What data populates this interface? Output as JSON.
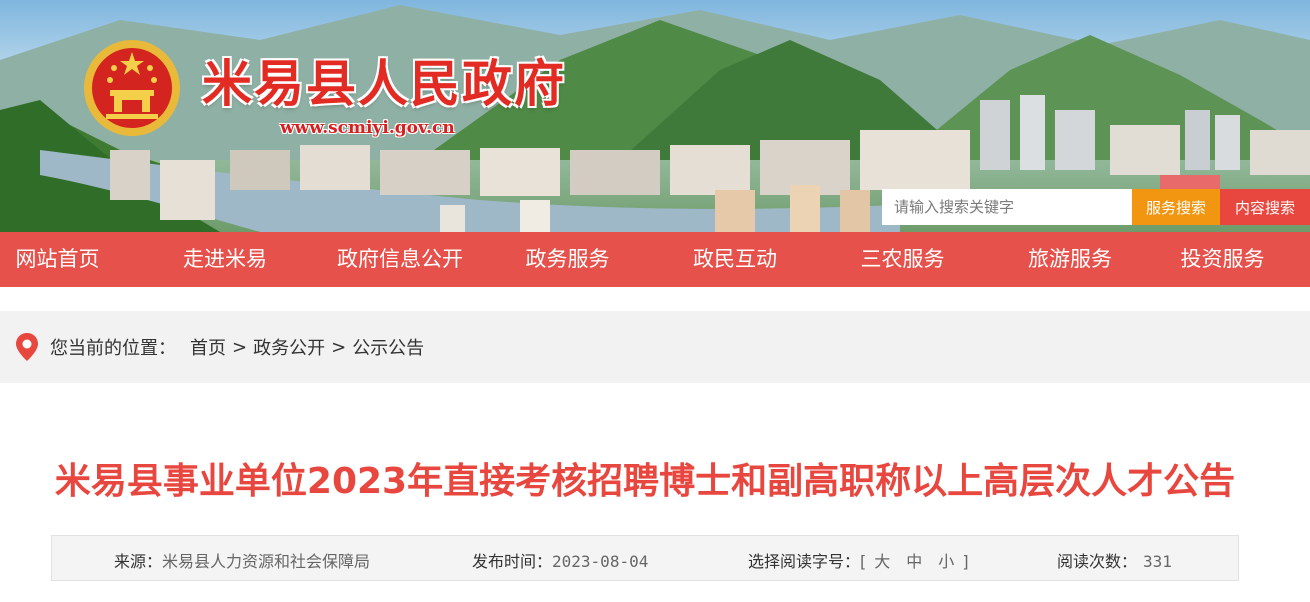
{
  "header": {
    "site_title": "米易县人民政府",
    "site_url": "www.scmiyi.gov.cn",
    "emblem": "national-emblem-icon"
  },
  "search": {
    "placeholder": "请输入搜索关键字",
    "service_button": "服务搜索",
    "content_button": "内容搜索"
  },
  "nav": {
    "items": [
      {
        "label": "网站首页"
      },
      {
        "label": "走进米易"
      },
      {
        "label": "政府信息公开"
      },
      {
        "label": "政务服务"
      },
      {
        "label": "政民互动"
      },
      {
        "label": "三农服务"
      },
      {
        "label": "旅游服务"
      },
      {
        "label": "投资服务"
      }
    ]
  },
  "breadcrumb": {
    "icon": "location-pin-icon",
    "label": "您当前的位置：",
    "items": [
      "首页",
      "政务公开",
      "公示公告"
    ],
    "separator": ">"
  },
  "article": {
    "title": "米易县事业单位2023年直接考核招聘博士和副高职称以上高层次人才公告",
    "source_label": "来源：",
    "source_value": "米易县人力资源和社会保障局",
    "date_label": "发布时间：",
    "date_value": "2023-08-04",
    "font_size_label": "选择阅读字号：",
    "font_size_open": "[",
    "font_size_options": [
      "大",
      "中",
      "小"
    ],
    "font_size_close": "]",
    "views_label": "阅读次数：",
    "views_value": "331"
  },
  "colors": {
    "nav_bg": "#e7514b",
    "title_red": "#e8473f",
    "search_orange": "#f29611",
    "site_title_red": "#e22b22"
  }
}
